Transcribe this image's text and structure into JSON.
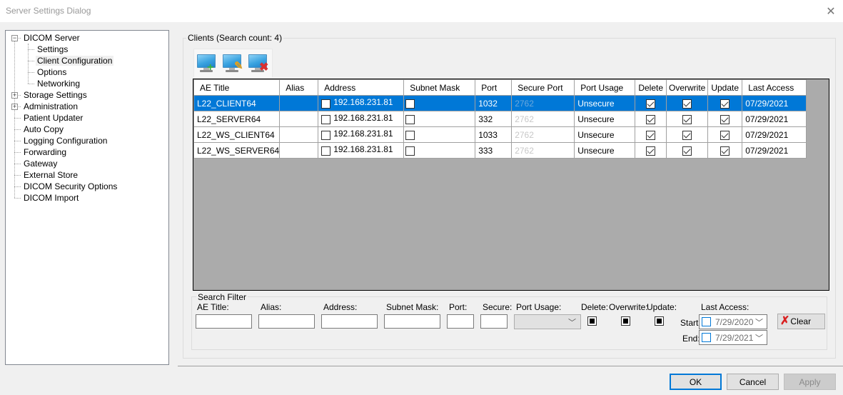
{
  "window": {
    "title": "Server Settings Dialog",
    "close_icon": "close-icon"
  },
  "tree": {
    "items": [
      {
        "label": "DICOM Server",
        "level": 0,
        "expander": "minus"
      },
      {
        "label": "Settings",
        "level": 1
      },
      {
        "label": "Client Configuration",
        "level": 1,
        "selected": true
      },
      {
        "label": "Options",
        "level": 1
      },
      {
        "label": "Networking",
        "level": 1
      },
      {
        "label": "Storage Settings",
        "level": 0,
        "expander": "plus"
      },
      {
        "label": "Administration",
        "level": 0,
        "expander": "plus"
      },
      {
        "label": "Patient Updater",
        "level": 0
      },
      {
        "label": "Auto Copy",
        "level": 0
      },
      {
        "label": "Logging Configuration",
        "level": 0
      },
      {
        "label": "Forwarding",
        "level": 0
      },
      {
        "label": "Gateway",
        "level": 0
      },
      {
        "label": "External Store",
        "level": 0
      },
      {
        "label": "DICOM Security Options",
        "level": 0
      },
      {
        "label": "DICOM Import",
        "level": 0
      }
    ]
  },
  "clients": {
    "group_label": "Clients (Search count: 4)",
    "toolbar": {
      "add_icon": "add-client-icon",
      "edit_icon": "edit-client-icon",
      "delete_icon": "delete-client-icon"
    },
    "columns": [
      "AE Title",
      "Alias",
      "Address",
      "Subnet Mask",
      "Port",
      "Secure Port",
      "Port Usage",
      "Delete",
      "Overwrite",
      "Update",
      "Last Access"
    ],
    "rows": [
      {
        "ae_title": "L22_CLIENT64",
        "alias": "",
        "address": "192.168.231.81",
        "address_checked": false,
        "subnet_checked": false,
        "port": "1032",
        "secure_port": "2762",
        "port_usage": "Unsecure",
        "delete": true,
        "overwrite": true,
        "update": true,
        "last_access": "07/29/2021",
        "selected": true
      },
      {
        "ae_title": "L22_SERVER64",
        "alias": "",
        "address": "192.168.231.81",
        "address_checked": false,
        "subnet_checked": false,
        "port": "332",
        "secure_port": "2762",
        "port_usage": "Unsecure",
        "delete": true,
        "overwrite": true,
        "update": true,
        "last_access": "07/29/2021",
        "selected": false
      },
      {
        "ae_title": "L22_WS_CLIENT64",
        "alias": "",
        "address": "192.168.231.81",
        "address_checked": false,
        "subnet_checked": false,
        "port": "1033",
        "secure_port": "2762",
        "port_usage": "Unsecure",
        "delete": true,
        "overwrite": true,
        "update": true,
        "last_access": "07/29/2021",
        "selected": false
      },
      {
        "ae_title": "L22_WS_SERVER64",
        "alias": "",
        "address": "192.168.231.81",
        "address_checked": false,
        "subnet_checked": false,
        "port": "333",
        "secure_port": "2762",
        "port_usage": "Unsecure",
        "delete": true,
        "overwrite": true,
        "update": true,
        "last_access": "07/29/2021",
        "selected": false
      }
    ]
  },
  "filter": {
    "group_label": "Search Filter",
    "ae_title_label": "AE Title:",
    "ae_title_value": "",
    "alias_label": "Alias:",
    "alias_value": "",
    "address_label": "Address:",
    "address_value": "",
    "subnet_label": "Subnet Mask:",
    "subnet_value": "",
    "port_label": "Port:",
    "port_value": "",
    "secure_label": "Secure:",
    "secure_value": "",
    "port_usage_label": "Port Usage:",
    "port_usage_value": "",
    "delete_label": "Delete:",
    "overwrite_label": "Overwrite:",
    "update_label": "Update:",
    "last_access_label": "Last Access:",
    "start_label": "Start:",
    "start_value": "7/29/2020",
    "end_label": "End:",
    "end_value": "7/29/2021",
    "clear_label": "Clear"
  },
  "footer": {
    "ok_label": "OK",
    "cancel_label": "Cancel",
    "apply_label": "Apply"
  },
  "colors": {
    "selection": "#0078d7",
    "grid_background": "#ababab"
  }
}
